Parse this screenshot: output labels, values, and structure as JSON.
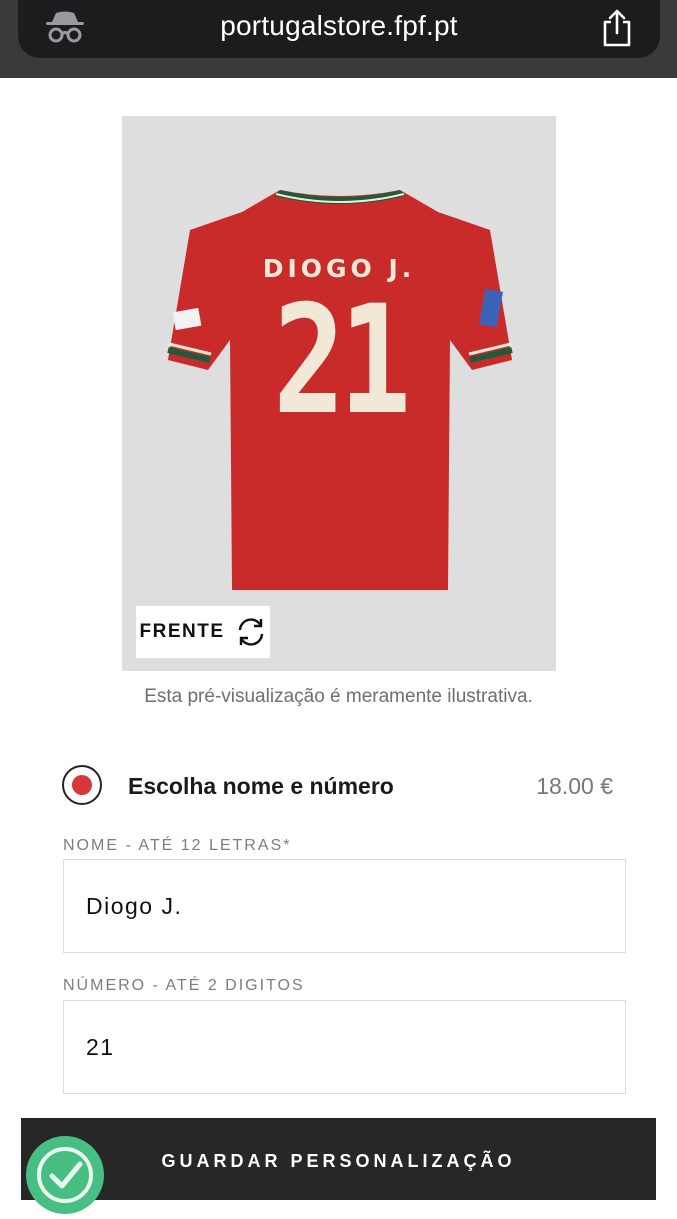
{
  "browser": {
    "url": "portugalstore.fpf.pt",
    "incognito_icon": "incognito-icon",
    "share_icon": "share-icon"
  },
  "preview": {
    "shirt_name": "DIOGO J.",
    "shirt_number": "21",
    "view_label": "FRENTE",
    "rotate_icon": "rotate-icon",
    "caption": "Esta pré-visualização é meramente ilustrativa.",
    "colors": {
      "shirt": "#c92b2b",
      "print": "#f2e8d8",
      "background": "#dedede"
    }
  },
  "option": {
    "label": "Escolha nome e número",
    "price": "18.00 €",
    "selected": true,
    "accent": "#d6373a"
  },
  "fields": {
    "name_label": "NOME - ATÉ 12 LETRAS*",
    "name_value": "Diogo J.",
    "number_label": "NÚMERO - ATÉ 2 DIGITOS",
    "number_value": "21"
  },
  "actions": {
    "save_label": "GUARDAR PERSONALIZAÇÃO",
    "badge_icon": "check-badge-icon"
  }
}
